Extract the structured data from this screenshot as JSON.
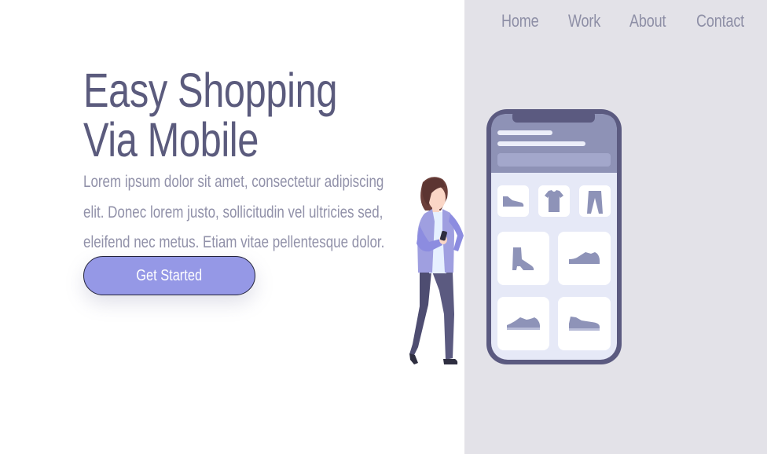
{
  "nav": {
    "items": [
      {
        "label": "Home"
      },
      {
        "label": "Work"
      },
      {
        "label": "About"
      },
      {
        "label": "Contact"
      }
    ]
  },
  "hero": {
    "title_line1": "Easy Shopping",
    "title_line2": "Via Mobile",
    "description_lines": [
      "Lorem ipsum dolor sit amet, consectetur adipiscing",
      "elit. Donec lorem justo, sollicitudin vel ultricies sed,",
      "eleifend nec metus. Etiam vitae pellentesque dolor."
    ],
    "cta_label": "Get Started"
  },
  "illustration": {
    "phone_items": [
      "sneaker-icon",
      "tshirt-icon",
      "pants-icon",
      "boot-icon",
      "shoe-icon",
      "sneaker-icon",
      "sneaker-icon"
    ],
    "person": "woman-with-phone"
  },
  "colors": {
    "panel_bg": "#e3e2e8",
    "title": "#5b5b7d",
    "text": "#9191a9",
    "nav": "#8e8fa6",
    "accent": "#9598e6",
    "phone_frame": "#5b5a80",
    "phone_header": "#8e92b6",
    "product_icon": "#8e93b8"
  }
}
